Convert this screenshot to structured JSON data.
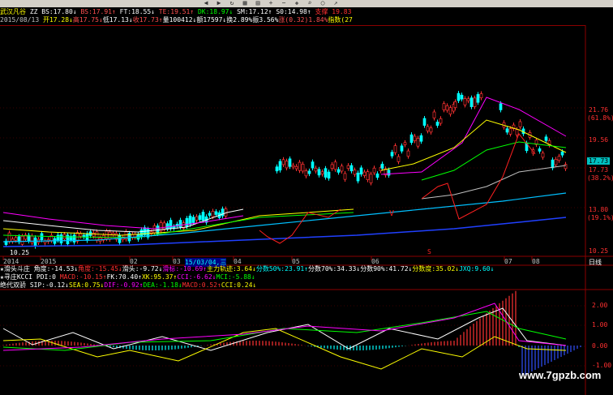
{
  "toolbar": {
    "icons": [
      "back-icon",
      "forward-icon",
      "refresh-icon",
      "grid-icon",
      "chart-icon",
      "zoom-in-icon",
      "zoom-out-icon",
      "cross-icon",
      "search-icon",
      "circle-icon",
      "arrow-icon"
    ]
  },
  "header1": [
    {
      "t": "武汉凡谷 ",
      "c": "#ffff00"
    },
    {
      "t": "ZZ ",
      "c": "#ffffff"
    },
    {
      "t": "BS:17.80↓ ",
      "c": "#ffffff"
    },
    {
      "t": "BS:17.91↑ ",
      "c": "#ff5050"
    },
    {
      "t": "FT:18.55↓ ",
      "c": "#ffffff"
    },
    {
      "t": "TE:19.51↑ ",
      "c": "#ff5050"
    },
    {
      "t": "DK:18.97↓ ",
      "c": "#00ff00"
    },
    {
      "t": "SM:17.12↑ ",
      "c": "#ffffff"
    },
    {
      "t": "S0:14.98↑ ",
      "c": "#ffffff"
    },
    {
      "t": "   支撑 19.83 ",
      "c": "#ff3030"
    }
  ],
  "header2": [
    {
      "t": "2015/08/13 ",
      "c": "#c0c0c0"
    },
    {
      "t": "开17.28↓",
      "c": "#ffff00"
    },
    {
      "t": "高17.75↓",
      "c": "#ff5050"
    },
    {
      "t": "低17.13↓",
      "c": "#ffffff"
    },
    {
      "t": "收17.73↑",
      "c": "#ff5050"
    },
    {
      "t": "量100412↓",
      "c": "#ffffff"
    },
    {
      "t": "额17597↓",
      "c": "#ffffff"
    },
    {
      "t": "换2.89%",
      "c": "#ffffff"
    },
    {
      "t": "振3.56%",
      "c": "#ffffff"
    },
    {
      "t": "涨(0.32)1.84%",
      "c": "#ff5050"
    },
    {
      "t": "指数(27",
      "c": "#ffff00"
    }
  ],
  "price_axis": [
    {
      "label": "21.76",
      "sub": "(61.8%)"
    },
    {
      "label": "19.56",
      "sub": ""
    },
    {
      "label": "17.73",
      "sub": "(38.2%)"
    },
    {
      "label": "13.80",
      "sub": "(19.1%)"
    },
    {
      "label": "10.25",
      "sub": ""
    }
  ],
  "current_price_tag": "17.73",
  "low_price_marker": "10.25",
  "date_axis": [
    "2014",
    "2015",
    "02",
    "03",
    "15/03/04,三",
    "04",
    "05",
    "06",
    "07",
    "08"
  ],
  "period_label": "日线",
  "indicator1": [
    {
      "t": "★滑头斗庄 ",
      "c": "#ffffff"
    },
    {
      "t": "角度:-14.53↓",
      "c": "#ffffff"
    },
    {
      "t": "角度:-15.45↓",
      "c": "#ff3030"
    },
    {
      "t": "滑头:-9.72↓",
      "c": "#ffffff"
    },
    {
      "t": "滑标:-10.69↑",
      "c": "#ff00ff"
    },
    {
      "t": "主力轨迹:3.64↓",
      "c": "#ffff00"
    },
    {
      "t": "分数50%:23.91↑",
      "c": "#00ffff"
    },
    {
      "t": "分数70%:34.33↓",
      "c": "#ffffff"
    },
    {
      "t": "分数90%:41.72↓",
      "c": "#ffffff"
    },
    {
      "t": "分数度:35.02↓",
      "c": "#ffff00"
    },
    {
      "t": "JXQ:9.60↓",
      "c": "#00ffff"
    }
  ],
  "indicator2": [
    {
      "t": "★寻庄KCCI ",
      "c": "#ffffff"
    },
    {
      "t": "PDI:0 ",
      "c": "#ffffff"
    },
    {
      "t": "MACD:-10.15↑",
      "c": "#ff3030"
    },
    {
      "t": "FK:70.40↑",
      "c": "#ffffff"
    },
    {
      "t": "XK:95.37↑",
      "c": "#ffff00"
    },
    {
      "t": "CCI:-6.62↓",
      "c": "#ff00ff"
    },
    {
      "t": "MCI:-5.88↓",
      "c": "#00ff00"
    }
  ],
  "indicator3": [
    {
      "t": "绝代双骄 ",
      "c": "#ffffff"
    },
    {
      "t": "SIP:-0.12↓",
      "c": "#ffffff"
    },
    {
      "t": "SEA:0.75↓",
      "c": "#ffff00"
    },
    {
      "t": "DIF:-0.92↑",
      "c": "#ff00ff"
    },
    {
      "t": "DEA:-1.18↓",
      "c": "#00ff00"
    },
    {
      "t": "MACD:0.52↑",
      "c": "#ff3030"
    },
    {
      "t": "CCI:0.24↓",
      "c": "#ffff00"
    }
  ],
  "indicator_axis": [
    "2.00",
    "1.00",
    "0.00",
    "-1.00"
  ],
  "watermark": "www.7gpzb.com",
  "colors": {
    "up": "#ff3232",
    "down": "#00ffff",
    "grid": "#8b0000",
    "axis_text": "#ff3030"
  }
}
